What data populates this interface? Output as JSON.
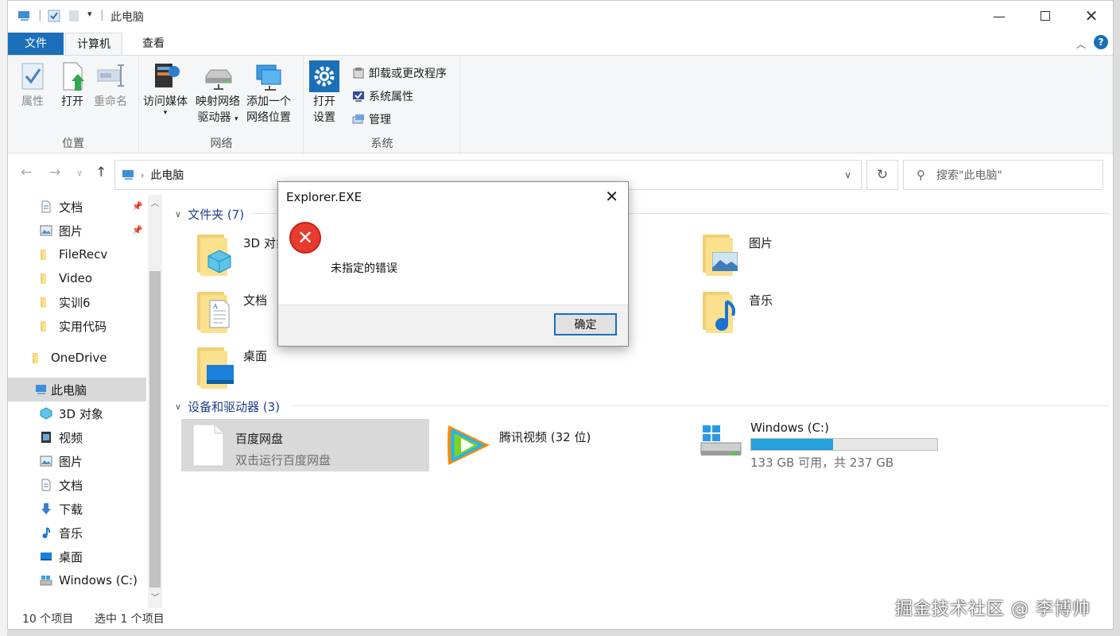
{
  "window": {
    "title": "此电脑",
    "minimize_icon": "minimize-icon",
    "maximize_icon": "maximize-icon",
    "close_icon": "close-icon"
  },
  "menu": {
    "file": "文件",
    "computer": "计算机",
    "view": "查看"
  },
  "ribbon": {
    "location": {
      "label": "位置",
      "properties": "属性",
      "open": "打开",
      "rename": "重命名"
    },
    "network": {
      "label": "网络",
      "access_media": "访问媒体",
      "map_drive_1": "映射网络",
      "map_drive_2": "驱动器",
      "add_location_1": "添加一个",
      "add_location_2": "网络位置"
    },
    "system": {
      "label": "系统",
      "open_settings_1": "打开",
      "open_settings_2": "设置",
      "uninstall": "卸载或更改程序",
      "system_properties": "系统属性",
      "manage": "管理"
    }
  },
  "address": {
    "path": "此电脑",
    "search_placeholder": "搜索\"此电脑\""
  },
  "sidebar": {
    "items": [
      {
        "label": "文档",
        "icon": "document-icon",
        "pinned": true
      },
      {
        "label": "图片",
        "icon": "picture-icon",
        "pinned": true
      },
      {
        "label": "FileRecv",
        "icon": "folder-icon"
      },
      {
        "label": "Video",
        "icon": "folder-icon"
      },
      {
        "label": "实训6",
        "icon": "folder-icon"
      },
      {
        "label": "实用代码",
        "icon": "folder-icon"
      },
      {
        "label": "OneDrive",
        "icon": "onedrive-icon"
      },
      {
        "label": "此电脑",
        "icon": "this-pc-icon",
        "selected": true
      },
      {
        "label": "3D 对象",
        "icon": "3d-objects-icon"
      },
      {
        "label": "视频",
        "icon": "video-icon"
      },
      {
        "label": "图片",
        "icon": "picture-icon"
      },
      {
        "label": "文档",
        "icon": "document-icon"
      },
      {
        "label": "下载",
        "icon": "download-icon"
      },
      {
        "label": "音乐",
        "icon": "music-icon"
      },
      {
        "label": "桌面",
        "icon": "desktop-icon"
      },
      {
        "label": "Windows (C:)",
        "icon": "drive-icon"
      }
    ]
  },
  "content": {
    "folders_header": "文件夹 (7)",
    "folders": [
      {
        "label": "3D 对象"
      },
      {
        "label": "图片"
      },
      {
        "label": "文档"
      },
      {
        "label": "音乐"
      },
      {
        "label": "桌面"
      }
    ],
    "devices_header": "设备和驱动器 (3)",
    "devices": [
      {
        "name": "百度网盘",
        "sub": "双击运行百度网盘"
      },
      {
        "name": "腾讯视频 (32 位)"
      },
      {
        "name": "Windows (C:)",
        "sub": "133 GB 可用，共 237 GB",
        "used_fraction": 0.44
      }
    ]
  },
  "status": {
    "count": "10 个项目",
    "selected": "选中 1 个项目"
  },
  "dialog": {
    "title": "Explorer.EXE",
    "message": "未指定的错误",
    "ok": "确定"
  },
  "watermark": "掘金技术社区 @ 李博帅",
  "colors": {
    "accent": "#1a6fb8",
    "error": "#e63b2e",
    "drive_fill": "#26a0da"
  }
}
